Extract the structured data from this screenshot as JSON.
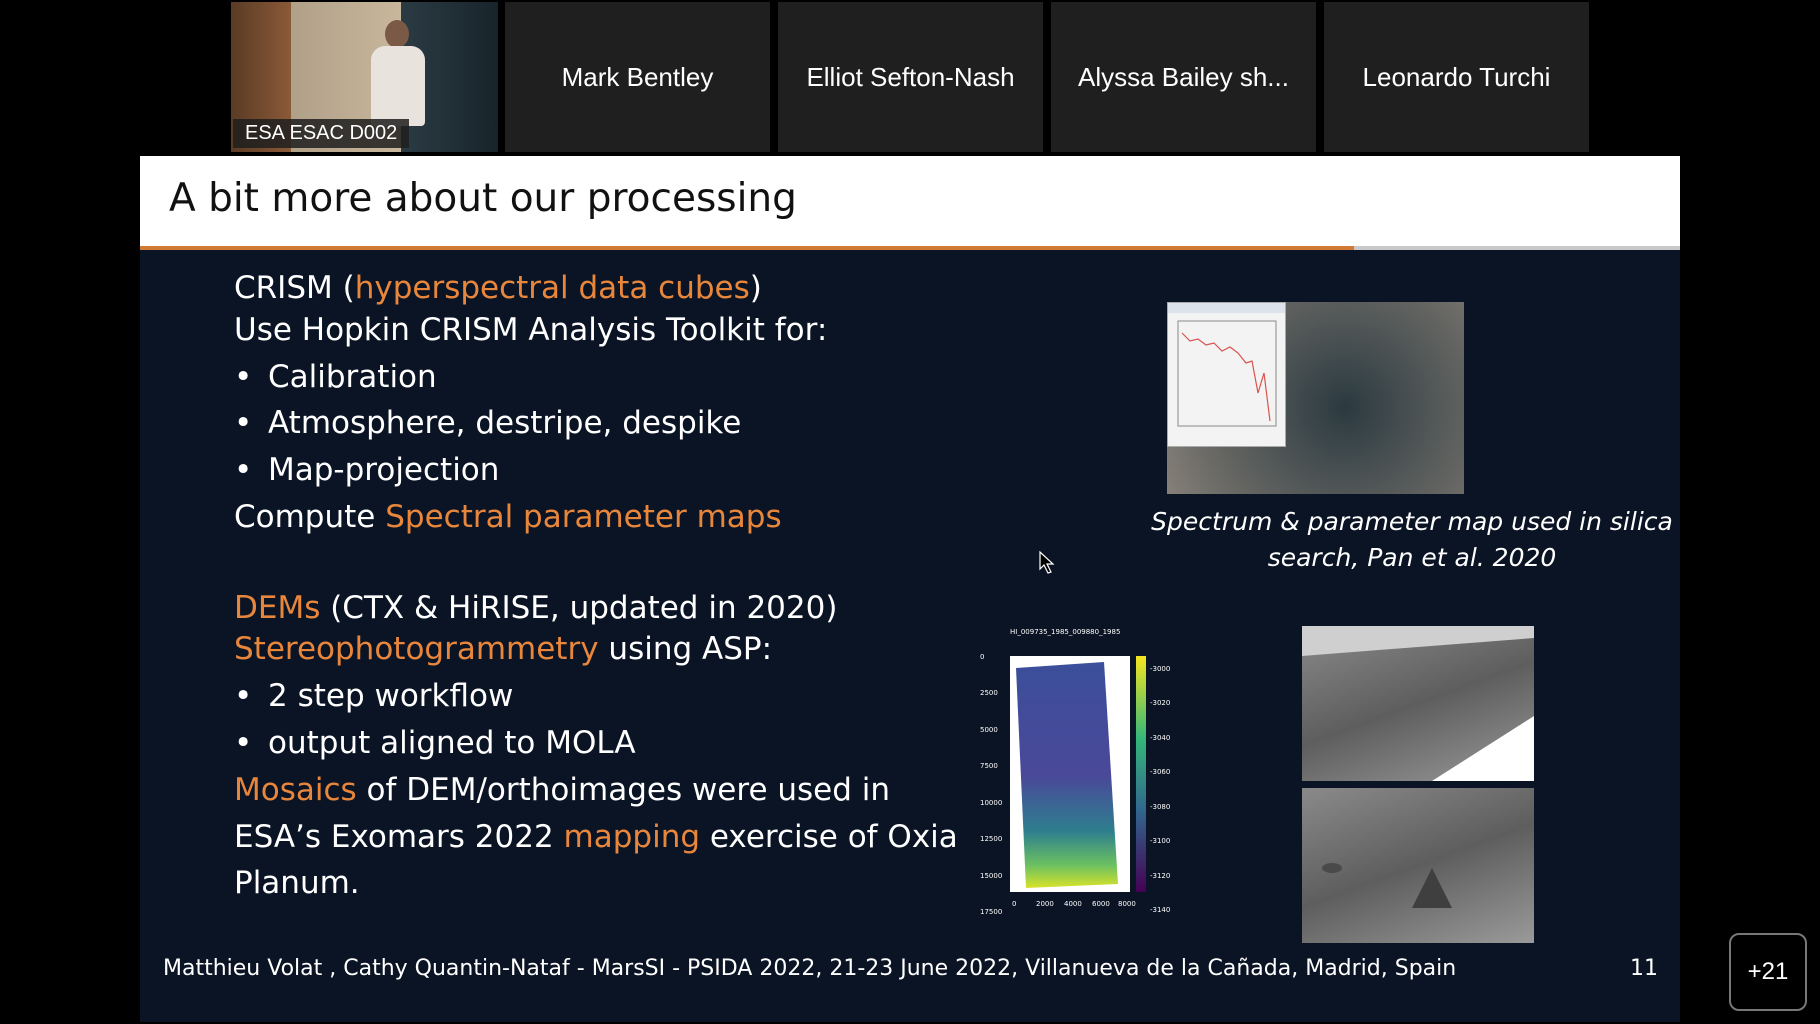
{
  "participants": {
    "video": {
      "label": "ESA ESAC D002"
    },
    "tiles": [
      "Mark Bentley",
      "Elliot Sefton-Nash",
      "Alyssa Bailey sh...",
      "Leonardo Turchi"
    ],
    "more_count": "+21"
  },
  "slide": {
    "title": "A bit more about our processing",
    "crism": {
      "heading_pre": "CRISM (",
      "heading_highlight": "hyperspectral data cubes",
      "heading_post": ")",
      "intro": "Use Hopkin CRISM Analysis Toolkit for:",
      "bullets": [
        "Calibration",
        "Atmosphere, destripe, despike",
        "Map-projection"
      ],
      "compute_pre": "Compute ",
      "compute_highlight": "Spectral parameter maps"
    },
    "dems": {
      "heading_highlight": "DEMs",
      "heading_post": " (CTX & HiRISE, updated in 2020)",
      "stereo_highlight": "Stereophotogrammetry",
      "stereo_post": " using ASP:",
      "bullets": [
        "2 step workflow",
        "output aligned to MOLA"
      ],
      "mosaic_highlight": "Mosaics",
      "mosaic_post": " of DEM/orthoimages were used in",
      "line2_pre": "ESA’s Exomars 2022 ",
      "line2_highlight": "mapping",
      "line2_post": " exercise of Oxia",
      "line3": "Planum."
    },
    "caption_line1": "Spectrum & parameter map used in silica",
    "caption_line2": "search, Pan et al. 2020",
    "dem_figure": {
      "title": "HI_009735_1985_009880_1985",
      "y_ticks": [
        "0",
        "2500",
        "5000",
        "7500",
        "10000",
        "12500",
        "15000",
        "17500"
      ],
      "x_ticks": [
        "0",
        "2000",
        "4000",
        "6000",
        "8000"
      ],
      "cbar_ticks": [
        "-3000",
        "-3020",
        "-3040",
        "-3060",
        "-3080",
        "-3100",
        "-3120",
        "-3140"
      ]
    },
    "footer": "Matthieu Volat , Cathy Quantin-Nataf - MarsSI  - PSIDA 2022, 21-23 June 2022, Villanueva de la Cañada, Madrid, Spain",
    "page_number": "11"
  }
}
